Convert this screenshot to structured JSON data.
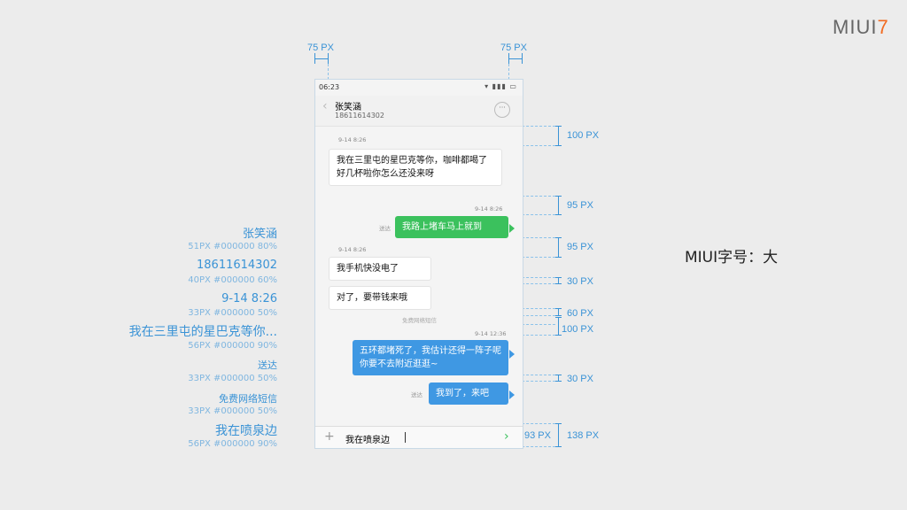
{
  "brand": {
    "logo_text": "MIUI",
    "logo_version": "7",
    "accent": "#f26b21"
  },
  "hint": "MIUI字号：大",
  "spec_list": [
    {
      "name": "张笑涵",
      "desc": "51PX  #000000  80%"
    },
    {
      "name": "18611614302",
      "desc": "40PX  #000000  60%"
    },
    {
      "name": "9-14 8:26",
      "desc": "33PX  #000000  50%"
    },
    {
      "name": "我在三里屯的星巴克等你...",
      "desc": "56PX  #000000  90%"
    },
    {
      "name": "送达",
      "desc": "33PX  #000000  50%"
    },
    {
      "name": "免费网络短信",
      "desc": "33PX  #000000  50%"
    },
    {
      "name": "我在喷泉边",
      "desc": "56PX  #000000  90%"
    }
  ],
  "measurements": {
    "left_margin": "75 PX",
    "right_margin": "75 PX",
    "m1": "100 PX",
    "m2": "95 PX",
    "m3": "95 PX",
    "m4": "30 PX",
    "m5": "60 PX",
    "m6": "100 PX",
    "m7": "30 PX",
    "m8": "93 PX",
    "m9": "138 PX"
  },
  "phone": {
    "status_time": "06:23",
    "status_icons": "▾ ▮▮▮ ▭",
    "contact_name": "张笑涵",
    "contact_number": "18611614302",
    "more": "···",
    "messages": {
      "ts1": "9-14 8:26",
      "msg1": "我在三里屯的星巴克等你，咖啡都喝了好几杯啦你怎么还没来呀",
      "ts2": "9-14 8:26",
      "sent1": "送达",
      "msg2": "我路上堵车马上就到",
      "ts3": "9-14 8:26",
      "msg3": "我手机快没电了",
      "msg4": "对了，要带钱来哦",
      "free_sms": "免费网络短信",
      "ts4": "9-14 12:36",
      "msg5": "五环都堵死了，我估计还得一阵子呢你要不去附近逛逛~",
      "sent2": "送达",
      "msg6": "我到了，来吧"
    },
    "input": {
      "plus": "+",
      "value": "我在喷泉边",
      "send": "›"
    }
  }
}
